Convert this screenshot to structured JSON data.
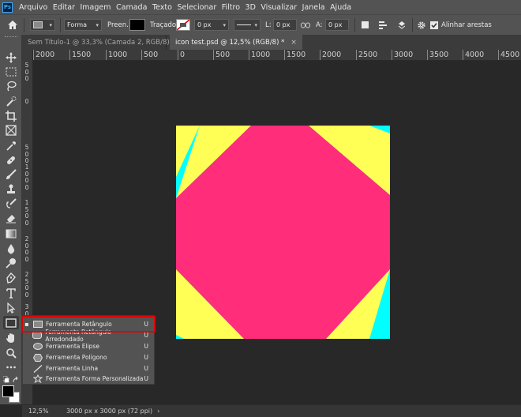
{
  "menu": [
    "Arquivo",
    "Editar",
    "Imagem",
    "Camada",
    "Texto",
    "Selecionar",
    "Filtro",
    "3D",
    "Visualizar",
    "Janela",
    "Ajuda"
  ],
  "options": {
    "mode_value": "Forma",
    "fill_label": "Preen.:",
    "stroke_label": "Traçado:",
    "stroke_width_value": "0 px",
    "width_label": "L:",
    "width_value": "0 px",
    "height_label": "A:",
    "height_value": "0 px",
    "align_edges_label": "Alinhar arestas",
    "align_edges_checked": true
  },
  "tabs": [
    {
      "label": "Sem Título-1 @ 33,3% (Camada 2, RGB/8) *",
      "active": false
    },
    {
      "label": "icon test.psd @ 12,5% (RGB/8) *",
      "active": true
    }
  ],
  "ruler_h": [
    "2000",
    "1500",
    "1000",
    "500",
    "0",
    "500",
    "1000",
    "1500",
    "2000",
    "2500",
    "3000",
    "3500",
    "4000",
    "4500"
  ],
  "ruler_v": [
    "5\n0\n0",
    "0",
    "5\n0\n0",
    "1\n0\n0\n0",
    "1\n5\n0\n0",
    "2\n0\n0\n0",
    "2\n5\n0\n0",
    "3\n0\n0\n0"
  ],
  "flyout": [
    {
      "label": "Ferramenta Retângulo",
      "shortcut": "U",
      "active": true,
      "icon": "rectangle-icon"
    },
    {
      "label": "Ferramenta Retângulo Arredondado",
      "shortcut": "U",
      "active": false,
      "icon": "rounded-rectangle-icon"
    },
    {
      "label": "Ferramenta Elipse",
      "shortcut": "U",
      "active": false,
      "icon": "ellipse-icon"
    },
    {
      "label": "Ferramenta Polígono",
      "shortcut": "U",
      "active": false,
      "icon": "polygon-icon"
    },
    {
      "label": "Ferramenta Linha",
      "shortcut": "U",
      "active": false,
      "icon": "line-icon"
    },
    {
      "label": "Ferramenta Forma Personalizada",
      "shortcut": "U",
      "active": false,
      "icon": "custom-shape-icon"
    }
  ],
  "status": {
    "zoom": "12,5%",
    "doc_info": "3000 px x 3000 px (72 ppi)"
  },
  "colors": {
    "document_background": "#00ffff",
    "document_triangles": "#ffff55",
    "document_octagon": "#ff2d7a",
    "fill_swatch": "#000000",
    "highlight_box": "#e00000"
  }
}
